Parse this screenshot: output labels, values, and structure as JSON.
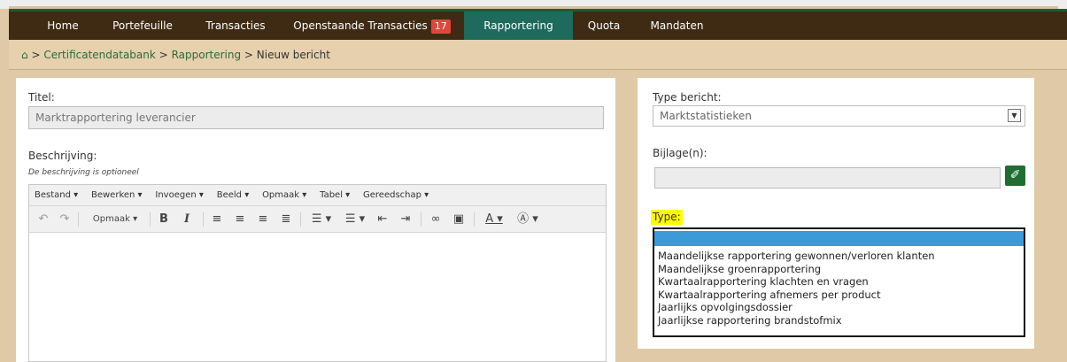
{
  "nav": {
    "items": [
      {
        "label": "Home"
      },
      {
        "label": "Portefeuille"
      },
      {
        "label": "Transacties"
      },
      {
        "label": "Openstaande Transacties",
        "badge": "17"
      },
      {
        "label": "Rapportering",
        "active": true
      },
      {
        "label": "Quota"
      },
      {
        "label": "Mandaten"
      }
    ]
  },
  "breadcrumb": {
    "sep1": ">",
    "link1": "Certificatendatabank",
    "sep2": ">",
    "link2": "Rapportering",
    "sep3": ">",
    "current": "Nieuw bericht"
  },
  "form": {
    "title_label": "Titel:",
    "title_value": "Marktrapportering leverancier",
    "desc_label": "Beschrijving:",
    "desc_hint": "De beschrijving is optioneel"
  },
  "editor": {
    "menus": [
      "Bestand ▾",
      "Bewerken ▾",
      "Invoegen ▾",
      "Beeld ▾",
      "Opmaak ▾",
      "Tabel ▾",
      "Gereedschap ▾"
    ],
    "format_label": "Opmaak ▾"
  },
  "right": {
    "type_bericht_label": "Type bericht:",
    "type_bericht_value": "Marktstatistieken",
    "bijlage_label": "Bijlage(n):",
    "type_label": "Type:",
    "type_options": [
      "",
      "Maandelijkse rapportering gewonnen/verloren klanten",
      "Maandelijkse groenrapportering",
      "Kwartaalrapportering klachten en vragen",
      "Kwartaalrapportering afnemers per product",
      "Jaarlijks opvolgingsdossier",
      "Jaarlijkse rapportering brandstofmix"
    ]
  },
  "colors": {
    "nav_bg": "#3f2b14",
    "nav_active": "#1e6a5c",
    "accent_green": "#1f6d31",
    "badge": "#e0463c",
    "highlight": "#fffb00",
    "selection": "#3c9ad9"
  }
}
